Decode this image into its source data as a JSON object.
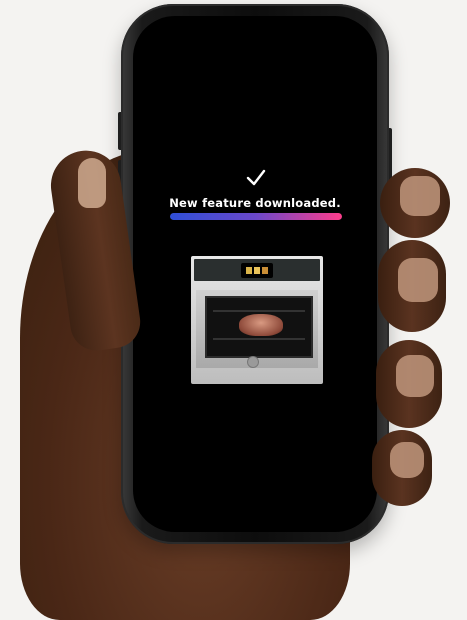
{
  "status": {
    "message": "New feature downloaded.",
    "progress_percent": 100
  },
  "icons": {
    "check": "check-icon"
  },
  "colors": {
    "background": "#f4f3f1",
    "screen": "#000000",
    "progress_start": "#2f4fd6",
    "progress_end": "#ff3d8b",
    "text": "#ffffff"
  }
}
